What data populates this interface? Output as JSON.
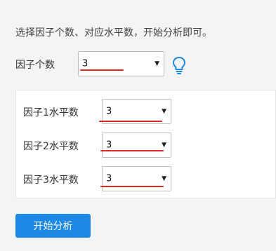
{
  "instruction": "选择因子个数、对应水平数，开始分析即可。",
  "factor_count": {
    "label": "因子个数",
    "value": "3"
  },
  "levels": [
    {
      "label": "因子1水平数",
      "value": "3"
    },
    {
      "label": "因子2水平数",
      "value": "3"
    },
    {
      "label": "因子3水平数",
      "value": "3"
    }
  ],
  "start_button": {
    "label": "开始分析"
  },
  "icons": {
    "hint": "lightbulb-icon",
    "dropdown": "caret-down-icon"
  },
  "colors": {
    "accent": "#1e88e5",
    "underline": "#e02424"
  }
}
